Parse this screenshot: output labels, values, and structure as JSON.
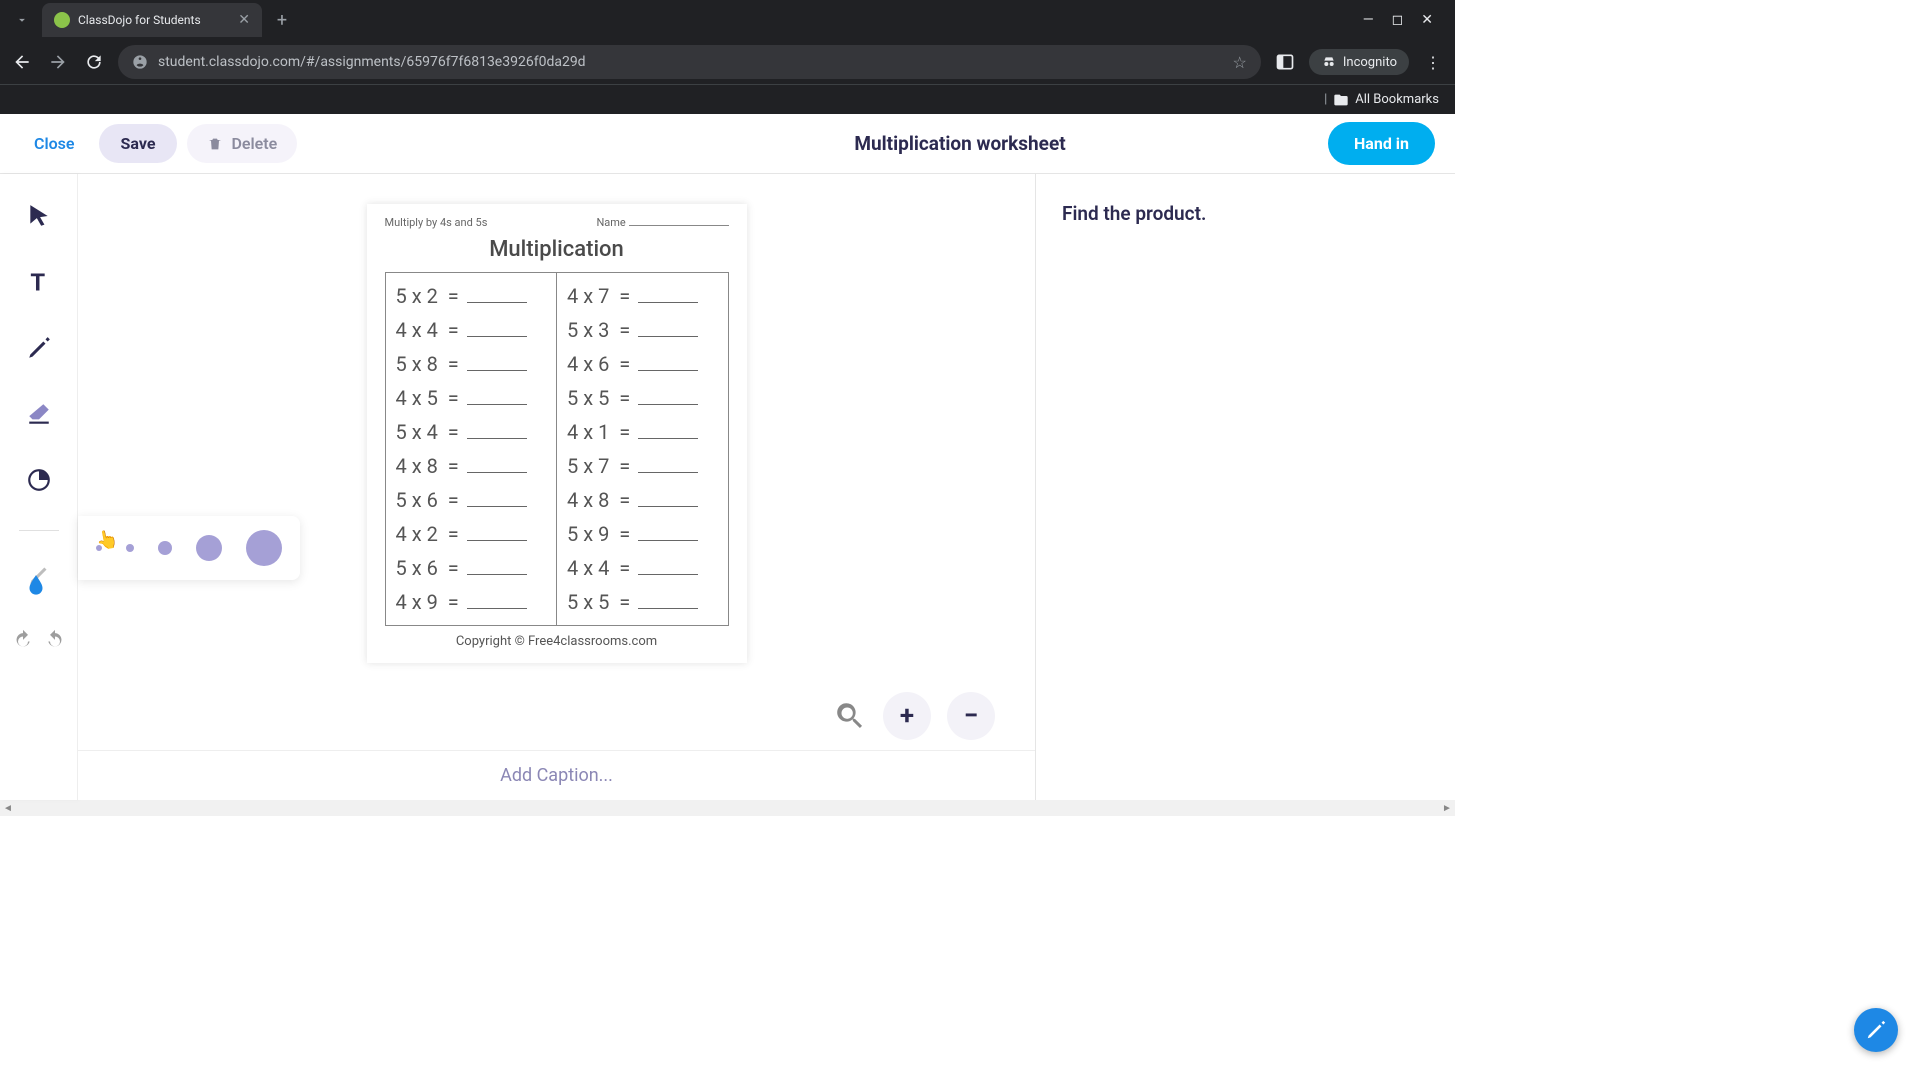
{
  "browser": {
    "tab_title": "ClassDojo for Students",
    "url": "student.classdojo.com/#/assignments/65976f7f6813e3926f0da29d",
    "incognito_label": "Incognito",
    "bookmarks_label": "All Bookmarks"
  },
  "header": {
    "close": "Close",
    "save": "Save",
    "delete": "Delete",
    "title": "Multiplication worksheet",
    "hand_in": "Hand in"
  },
  "worksheet": {
    "top_instruction": "Multiply by 4s and 5s",
    "name_label": "Name",
    "title": "Multiplication",
    "left_col": [
      "5 x 2  =",
      "4 x 4  =",
      "5 x 8  =",
      "4 x 5  =",
      "5 x 4  =",
      "4 x 8  =",
      "5 x 6  =",
      "4 x 2  =",
      "5 x 6  =",
      "4 x 9  ="
    ],
    "right_col": [
      "4 x 7  =",
      "5 x 3  =",
      "4 x 6  =",
      "5 x 5  =",
      "4 x 1  =",
      "5 x 7  =",
      "4 x 8  =",
      "5 x 9  =",
      "4 x 4  =",
      "5 x 5  ="
    ],
    "copyright": "Copyright © Free4classrooms.com"
  },
  "right_panel": {
    "instruction": "Find the product."
  },
  "caption_placeholder": "Add Caption...",
  "zoom": {
    "plus": "+",
    "minus": "−"
  }
}
